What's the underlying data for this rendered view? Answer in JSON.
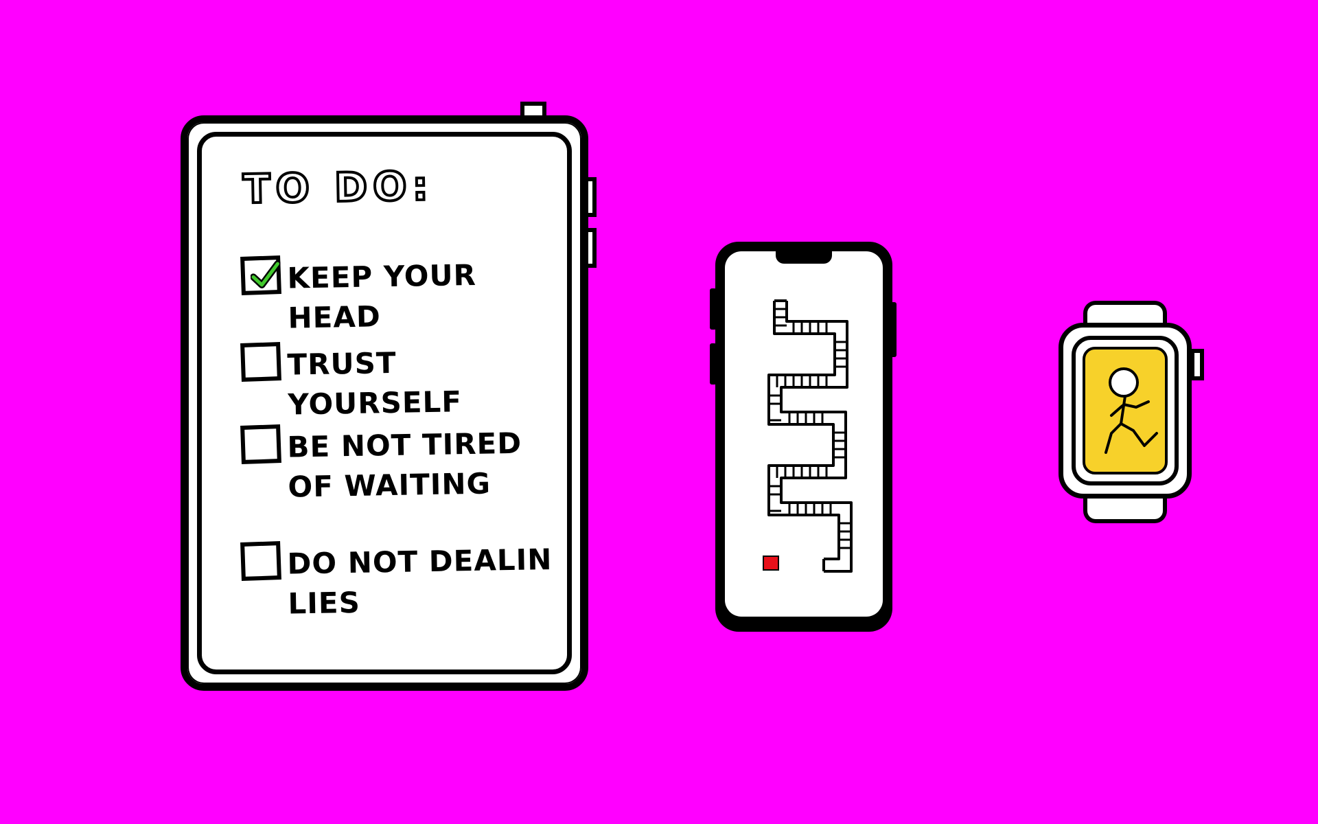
{
  "colors": {
    "background": "#ff00ff",
    "check": "#41c82c",
    "watch_screen": "#f7d12a",
    "maze_marker": "#e8101a"
  },
  "tablet": {
    "title": "TO DO:",
    "items": [
      {
        "label": "KEEP YOUR HEAD",
        "checked": true
      },
      {
        "label": "TRUST YOURSELF",
        "checked": false
      },
      {
        "label": "BE NOT TIRED\nOF WAITING",
        "checked": false
      },
      {
        "label": "DO NOT DEALIN\nLIES",
        "checked": false
      }
    ]
  },
  "phone": {
    "screen_icon": "maze-icon",
    "marker_icon": "red-square-icon"
  },
  "watch": {
    "screen_icon": "running-figure-icon"
  }
}
